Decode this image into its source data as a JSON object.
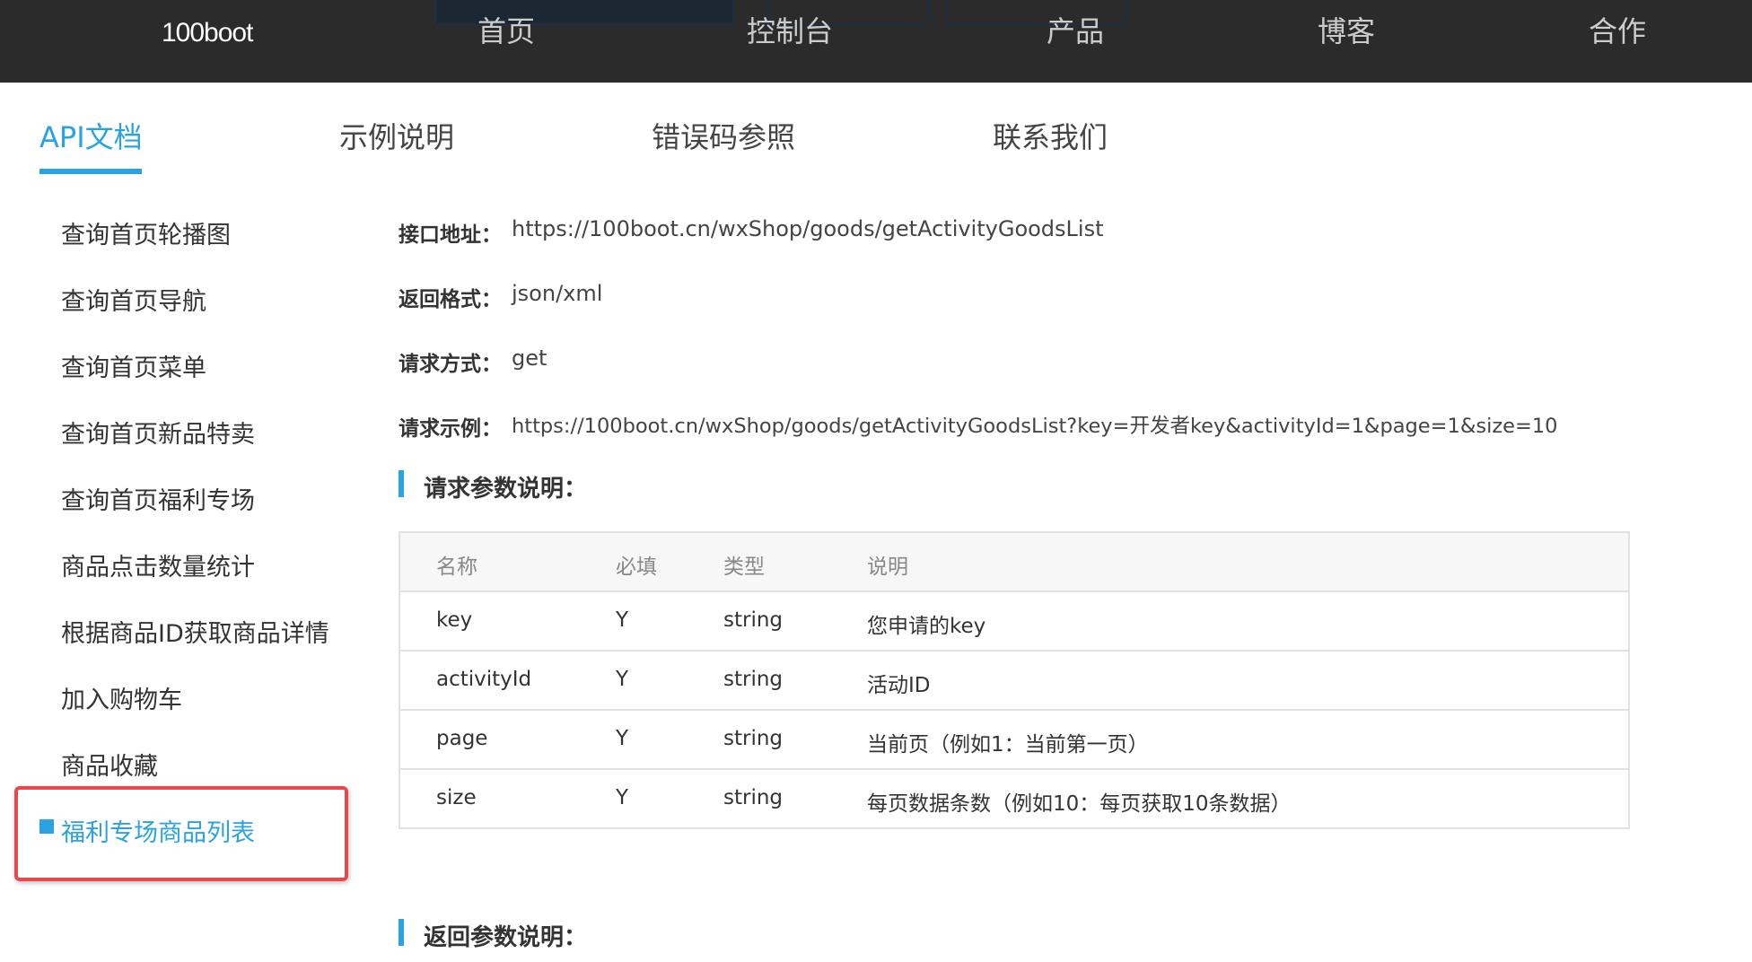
{
  "topnav": {
    "logo": "100boot",
    "items": [
      "首页",
      "控制台",
      "产品",
      "博客",
      "合作"
    ]
  },
  "tabs": [
    "API文档",
    "示例说明",
    "错误码参照",
    "联系我们"
  ],
  "sidebar": {
    "items": [
      "查询首页轮播图",
      "查询首页导航",
      "查询首页菜单",
      "查询首页新品特卖",
      "查询首页福利专场",
      "商品点击数量统计",
      "根据商品ID获取商品详情",
      "加入购物车",
      "商品收藏",
      "福利专场商品列表"
    ]
  },
  "info": {
    "endpoint_label": "接口地址：",
    "endpoint_value": "https://100boot.cn/wxShop/goods/getActivityGoodsList",
    "format_label": "返回格式：",
    "format_value": "json/xml",
    "method_label": "请求方式：",
    "method_value": "get",
    "example_label": "请求示例：",
    "example_value": "https://100boot.cn/wxShop/goods/getActivityGoodsList?key=开发者key&activityId=1&page=1&size=10"
  },
  "request_section": {
    "title": "请求参数说明：",
    "headers": [
      "名称",
      "必填",
      "类型",
      "说明"
    ],
    "rows": [
      [
        "key",
        "Y",
        "string",
        "您申请的key"
      ],
      [
        "activityId",
        "Y",
        "string",
        "活动ID"
      ],
      [
        "page",
        "Y",
        "string",
        "当前页（例如1：当前第一页）"
      ],
      [
        "size",
        "Y",
        "string",
        "每页数据条数（例如10：每页获取10条数据）"
      ]
    ]
  },
  "response_section": {
    "title": "返回参数说明："
  },
  "colors": {
    "accent": "#2aa3e0",
    "nav_bg": "#2b2b2b",
    "highlight": "#e5484d"
  }
}
